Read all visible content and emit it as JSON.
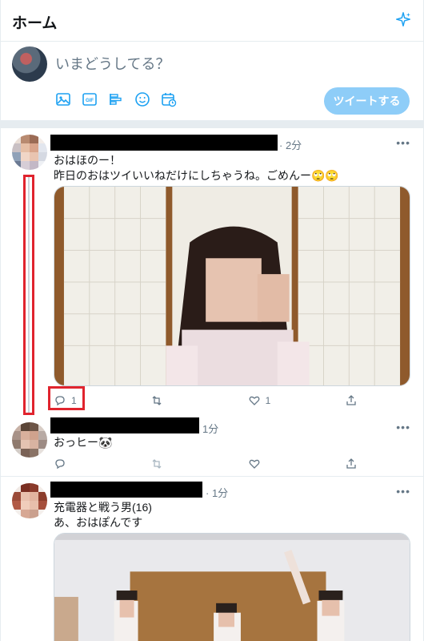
{
  "header": {
    "title": "ホーム",
    "sparkle_icon": "sparkle-icon"
  },
  "compose": {
    "placeholder": "いまどうしてる？",
    "tools": [
      "image-icon",
      "gif-icon",
      "poll-icon",
      "emoji-icon",
      "schedule-icon"
    ],
    "tweet_button": "ツイートする"
  },
  "tweets": [
    {
      "time": "· 2分",
      "more": "•••",
      "lines": [
        "おはほのー！",
        "昨日のおはツイいいねだけにしちゃうね。ごめんー🙄🙄"
      ],
      "reply_count": "1",
      "retweet_count": "",
      "like_count": "1"
    },
    {
      "time": "1分",
      "more": "•••",
      "lines": [
        "おっヒー🐼"
      ],
      "reply_count": "",
      "retweet_count": "",
      "like_count": ""
    },
    {
      "time": "· 1分",
      "more": "•••",
      "lines": [
        "充電器と戦う男(16)",
        "あ、おはぽんです"
      ]
    }
  ],
  "colors": {
    "accent": "#1da1f2",
    "button_disabled": "#8ecdf8",
    "highlight": "#e0242e",
    "secondary_text": "#657786"
  }
}
